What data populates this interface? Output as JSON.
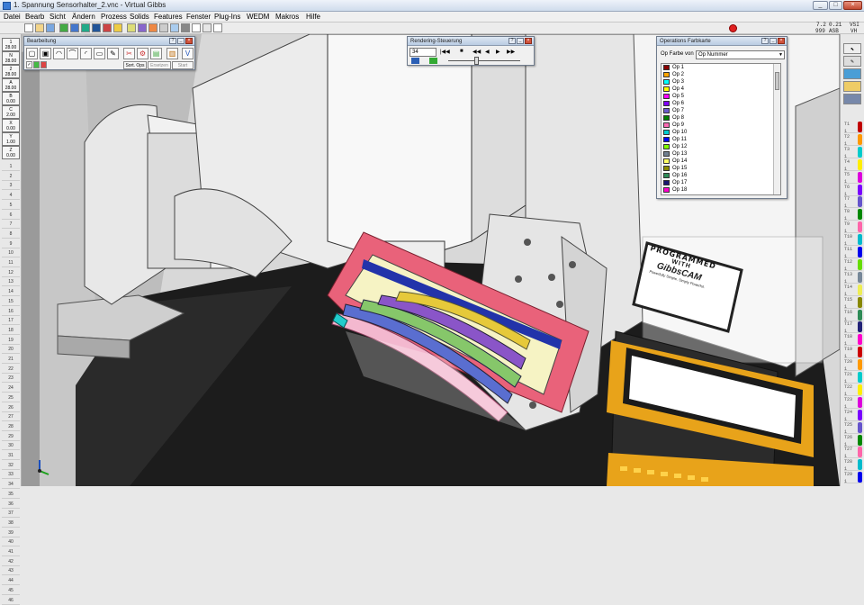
{
  "window": {
    "title": "1. Spannung Sensorhalter_2.vnc - Virtual Gibbs",
    "min_glyph": "_",
    "max_glyph": "□",
    "close_glyph": "×"
  },
  "menu": [
    "Datei",
    "Bearb",
    "Sicht",
    "Ändern",
    "Prozess",
    "Solids",
    "Features",
    "Fenster",
    "Plug-Ins",
    "WEDM",
    "Makros",
    "Hilfe"
  ],
  "status_readout": {
    "top_left": "7.2",
    "top_mid": "0.21",
    "top_right": "VSI",
    "bottom_left": "999",
    "bottom_mid": "ASB",
    "bottom_right": "VH"
  },
  "left_tools": [
    {
      "label": "1\n28.00"
    },
    {
      "label": "N\n28.00"
    },
    {
      "label": "2\n28.00"
    },
    {
      "label": "A\n28.00"
    },
    {
      "label": "B\n0.00"
    },
    {
      "label": "C\n2.00"
    },
    {
      "label": "X\n0.00"
    },
    {
      "label": "Y\n1.00"
    },
    {
      "label": "Z\n0.00"
    }
  ],
  "row_numbers": [
    "1",
    "2",
    "3",
    "4",
    "5",
    "6",
    "7",
    "8",
    "9",
    "10",
    "11",
    "12",
    "13",
    "14",
    "15",
    "16",
    "17",
    "18",
    "19",
    "20",
    "21",
    "22",
    "23",
    "24",
    "25",
    "26",
    "27",
    "28",
    "29",
    "30",
    "31",
    "32",
    "33",
    "34",
    "35",
    "36",
    "37",
    "38",
    "39",
    "40",
    "41",
    "42",
    "43",
    "44",
    "45",
    "46"
  ],
  "edit_palette": {
    "title": "Bearbeitung",
    "buttons": [
      "Sort. Ops",
      "Ersetzen",
      "Start"
    ]
  },
  "render_palette": {
    "title": "Rendering-Steuerung",
    "counter": "34",
    "buttons": [
      "|◀◀",
      "■",
      "◀◀",
      "◀",
      "▶",
      "▶▶"
    ]
  },
  "ops_palette": {
    "title": "Operations Farbkarte",
    "label": "Op Farbe von",
    "dropdown_value": "Op Nummer",
    "ops": [
      {
        "name": "Op 1",
        "color": "#8b0000"
      },
      {
        "name": "Op 2",
        "color": "#ffa500"
      },
      {
        "name": "Op 3",
        "color": "#00ffff"
      },
      {
        "name": "Op 4",
        "color": "#ffff00"
      },
      {
        "name": "Op 5",
        "color": "#ff00ff"
      },
      {
        "name": "Op 6",
        "color": "#8000ff"
      },
      {
        "name": "Op 7",
        "color": "#6a5acd"
      },
      {
        "name": "Op 8",
        "color": "#008000"
      },
      {
        "name": "Op 9",
        "color": "#ff69b4"
      },
      {
        "name": "Op 10",
        "color": "#00ced1"
      },
      {
        "name": "Op 11",
        "color": "#0000ff"
      },
      {
        "name": "Op 12",
        "color": "#7fff00"
      },
      {
        "name": "Op 13",
        "color": "#708090"
      },
      {
        "name": "Op 14",
        "color": "#ffff66"
      },
      {
        "name": "Op 15",
        "color": "#8b8b00"
      },
      {
        "name": "Op 16",
        "color": "#2e8b57"
      },
      {
        "name": "Op 17",
        "color": "#191970"
      },
      {
        "name": "Op 18",
        "color": "#ff00cc"
      }
    ]
  },
  "right_ops": [
    {
      "label": "T1\n1",
      "color": "#c00000"
    },
    {
      "label": "T2\n1",
      "color": "#ff9900"
    },
    {
      "label": "T3\n1",
      "color": "#00cccc"
    },
    {
      "label": "T4\n1",
      "color": "#ffee00"
    },
    {
      "label": "T5\n1",
      "color": "#dd00dd"
    },
    {
      "label": "T6\n1",
      "color": "#7a00ff"
    },
    {
      "label": "T7\n1",
      "color": "#6655cc"
    },
    {
      "label": "T8\n1",
      "color": "#008800"
    },
    {
      "label": "T9\n1",
      "color": "#ff66aa"
    },
    {
      "label": "T10\n1",
      "color": "#00bbcc"
    },
    {
      "label": "T11\n1",
      "color": "#0000ee"
    },
    {
      "label": "T12\n1",
      "color": "#66dd00"
    },
    {
      "label": "T13\n1",
      "color": "#778899"
    },
    {
      "label": "T14\n1",
      "color": "#eeee55"
    },
    {
      "label": "T15\n1",
      "color": "#888800"
    },
    {
      "label": "T16\n1",
      "color": "#2e8b57"
    },
    {
      "label": "T17\n1",
      "color": "#222277"
    },
    {
      "label": "T18\n1",
      "color": "#ff00cc"
    },
    {
      "label": "T19\n1",
      "color": "#cc0000"
    },
    {
      "label": "T20\n1",
      "color": "#ff9900"
    },
    {
      "label": "T21\n1",
      "color": "#00cccc"
    },
    {
      "label": "T22\n1",
      "color": "#ffee00"
    },
    {
      "label": "T23\n1",
      "color": "#dd00dd"
    },
    {
      "label": "T24\n1",
      "color": "#7a00ff"
    },
    {
      "label": "T25\n1",
      "color": "#6655cc"
    },
    {
      "label": "T26\n1",
      "color": "#008800"
    },
    {
      "label": "T27\n1",
      "color": "#ff66aa"
    },
    {
      "label": "T28\n1",
      "color": "#00bbcc"
    },
    {
      "label": "T29\n1",
      "color": "#0000ee"
    }
  ],
  "sign": {
    "line1": "Programmed",
    "line2": "with",
    "line3": "GibbsCAM",
    "line4": "Powerfully Simple. Simply Powerful."
  }
}
